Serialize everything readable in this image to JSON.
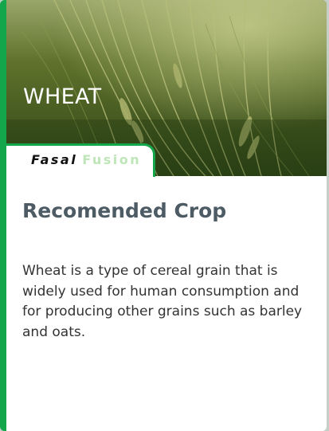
{
  "hero": {
    "title": "WHEAT"
  },
  "brand": {
    "part1": "Fasal",
    "part2": "Fusion"
  },
  "content": {
    "heading": "Recomended Crop",
    "description": "Wheat is a type of cereal grain that is widely used for human consumption and for producing other grains such as barley and oats."
  },
  "colors": {
    "accent_green": "#14a64a",
    "brand_light_green": "#bfe6b8",
    "heading_gray": "#4d5b65"
  }
}
